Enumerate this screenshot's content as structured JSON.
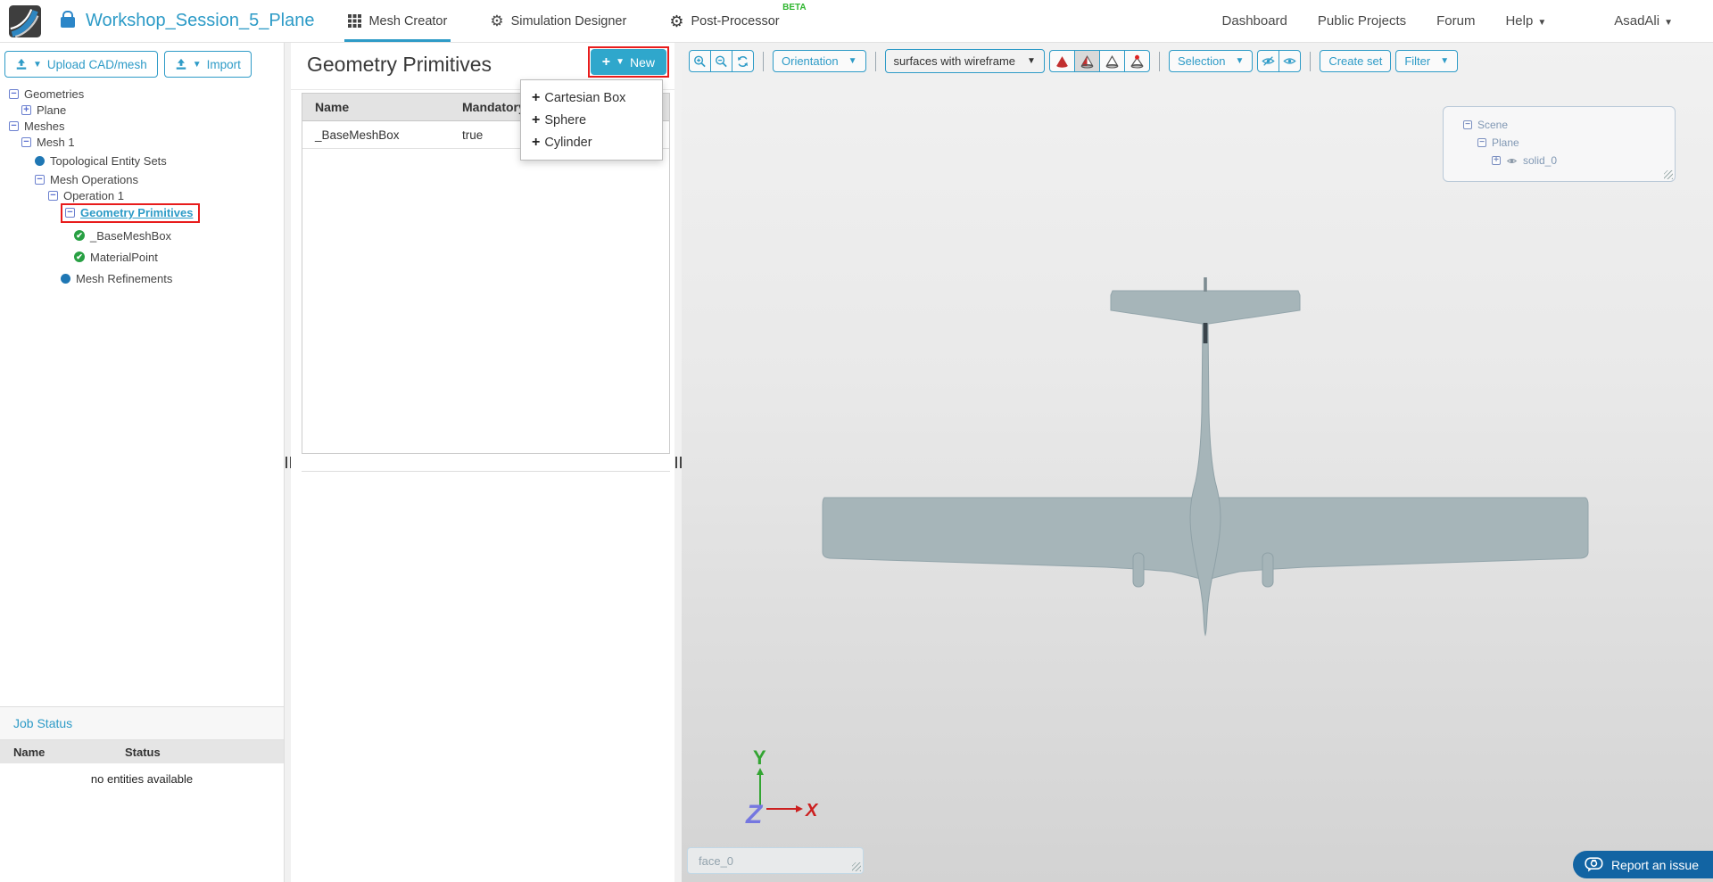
{
  "navbar": {
    "project_title": "Workshop_Session_5_Plane",
    "tabs": [
      {
        "label": "Mesh Creator"
      },
      {
        "label": "Simulation Designer"
      },
      {
        "label": "Post-Processor",
        "badge": "BETA"
      }
    ],
    "links": [
      {
        "label": "Dashboard"
      },
      {
        "label": "Public Projects"
      },
      {
        "label": "Forum"
      },
      {
        "label": "Help"
      }
    ],
    "user": "AsadAli"
  },
  "sidebar": {
    "upload_button": "Upload CAD/mesh",
    "import_button": "Import",
    "tree": [
      {
        "label": "Geometries",
        "icon": "collapse-box"
      },
      {
        "label": "Plane",
        "icon": "expand-box"
      },
      {
        "label": "Meshes",
        "icon": "collapse-box"
      },
      {
        "label": "Mesh 1",
        "icon": "collapse-box"
      },
      {
        "label": "Topological Entity Sets",
        "icon": "blue-dot"
      },
      {
        "label": "Mesh Operations",
        "icon": "collapse-box"
      },
      {
        "label": "Operation 1",
        "icon": "collapse-box"
      },
      {
        "label": "Geometry Primitives",
        "icon": "collapse-box",
        "highlighted": true
      },
      {
        "label": "_BaseMeshBox",
        "icon": "green-check"
      },
      {
        "label": "MaterialPoint",
        "icon": "green-check"
      },
      {
        "label": "Mesh Refinements",
        "icon": "blue-dot"
      }
    ],
    "job_status": {
      "title": "Job Status",
      "columns": [
        "Name",
        "Status"
      ],
      "empty_message": "no entities available"
    }
  },
  "panel": {
    "title": "Geometry Primitives",
    "new_button": "New",
    "menu": [
      {
        "label": "Cartesian Box"
      },
      {
        "label": "Sphere"
      },
      {
        "label": "Cylinder"
      }
    ],
    "table": {
      "columns": [
        "Name",
        "Mandatory"
      ],
      "rows": [
        {
          "name": "_BaseMeshBox",
          "mandatory": "true"
        }
      ]
    }
  },
  "viewport": {
    "toolbar": {
      "orientation": "Orientation",
      "render_mode": "surfaces with wireframe",
      "selection": "Selection",
      "create_set": "Create set",
      "filter": "Filter"
    },
    "scene_tree": [
      {
        "label": "Scene"
      },
      {
        "label": "Plane"
      },
      {
        "label": "solid_0"
      }
    ],
    "axis": {
      "x": "X",
      "y": "Y",
      "z": "Z"
    },
    "face_label": "face_0",
    "report_button": "Report an issue"
  },
  "colors": {
    "accent_blue": "#2e9bc7",
    "new_button_cyan": "#2fa7cc",
    "annotation_red": "#e81c1c",
    "beta_green": "#2eb52e",
    "report_blue": "#1264a3",
    "model_gray": "#a6b5b9"
  }
}
